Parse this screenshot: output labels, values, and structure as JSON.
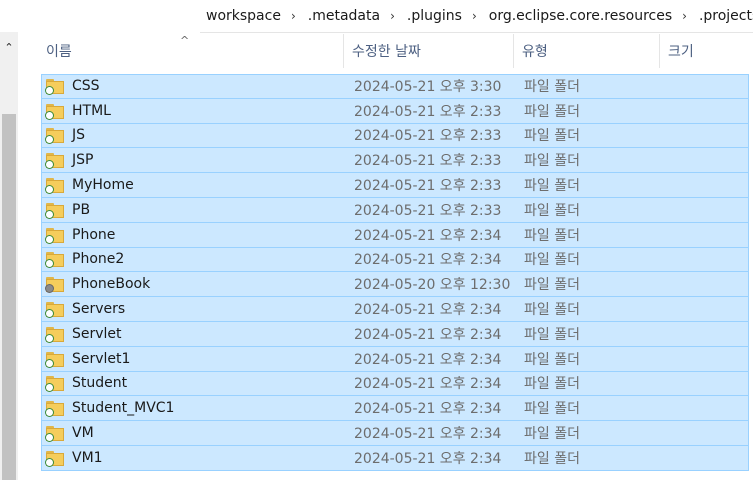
{
  "breadcrumb": [
    "workspace",
    ".metadata",
    ".plugins",
    "org.eclipse.core.resources",
    ".projects"
  ],
  "breadcrumb_separator": "›",
  "scroll_up_glyph": "⌃",
  "columns": {
    "name": "이름",
    "date": "수정한 날짜",
    "type": "유형",
    "size": "크기",
    "sort_glyph": "^"
  },
  "files": [
    {
      "name": "CSS",
      "date": "2024-05-21 오후 3:30",
      "type": "파일 폴더",
      "badge": "green"
    },
    {
      "name": "HTML",
      "date": "2024-05-21 오후 2:33",
      "type": "파일 폴더",
      "badge": "green"
    },
    {
      "name": "JS",
      "date": "2024-05-21 오후 2:33",
      "type": "파일 폴더",
      "badge": "green"
    },
    {
      "name": "JSP",
      "date": "2024-05-21 오후 2:33",
      "type": "파일 폴더",
      "badge": "green"
    },
    {
      "name": "MyHome",
      "date": "2024-05-21 오후 2:33",
      "type": "파일 폴더",
      "badge": "green"
    },
    {
      "name": "PB",
      "date": "2024-05-21 오후 2:33",
      "type": "파일 폴더",
      "badge": "green"
    },
    {
      "name": "Phone",
      "date": "2024-05-21 오후 2:34",
      "type": "파일 폴더",
      "badge": "green"
    },
    {
      "name": "Phone2",
      "date": "2024-05-21 오후 2:34",
      "type": "파일 폴더",
      "badge": "green"
    },
    {
      "name": "PhoneBook",
      "date": "2024-05-20 오후 12:30",
      "type": "파일 폴더",
      "badge": "grey"
    },
    {
      "name": "Servers",
      "date": "2024-05-21 오후 2:34",
      "type": "파일 폴더",
      "badge": "green"
    },
    {
      "name": "Servlet",
      "date": "2024-05-21 오후 2:34",
      "type": "파일 폴더",
      "badge": "green"
    },
    {
      "name": "Servlet1",
      "date": "2024-05-21 오후 2:34",
      "type": "파일 폴더",
      "badge": "green"
    },
    {
      "name": "Student",
      "date": "2024-05-21 오후 2:34",
      "type": "파일 폴더",
      "badge": "green"
    },
    {
      "name": "Student_MVC1",
      "date": "2024-05-21 오후 2:34",
      "type": "파일 폴더",
      "badge": "green"
    },
    {
      "name": "VM",
      "date": "2024-05-21 오후 2:34",
      "type": "파일 폴더",
      "badge": "green"
    },
    {
      "name": "VM1",
      "date": "2024-05-21 오후 2:34",
      "type": "파일 폴더",
      "badge": "green"
    }
  ]
}
